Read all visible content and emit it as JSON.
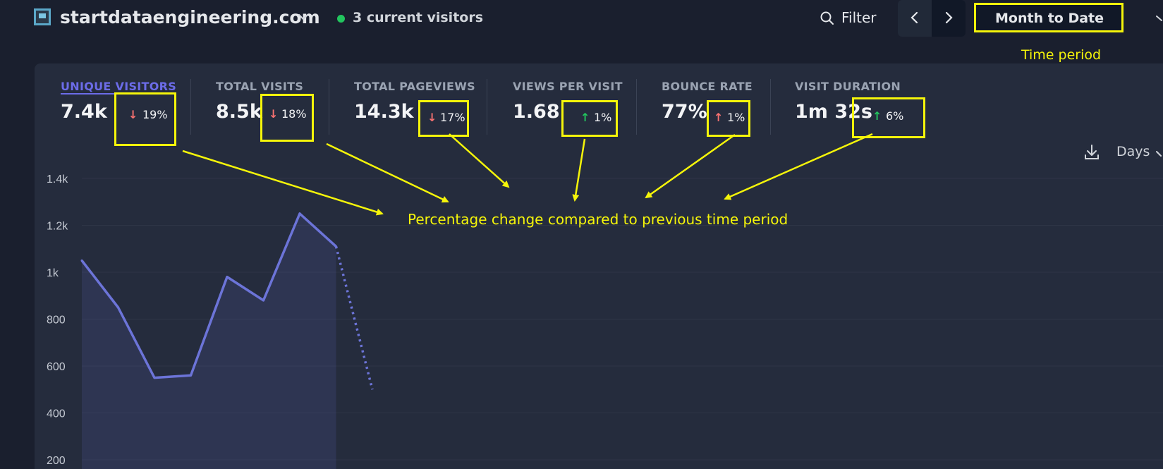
{
  "header": {
    "site_name": "startdataengineering.com",
    "current_visitors": "3 current visitors",
    "filter_label": "Filter",
    "period_label": "Month to Date",
    "period_note": "Time period"
  },
  "metrics": [
    {
      "label": "UNIQUE VISITORS",
      "value": "7.4k",
      "change": "19%",
      "direction": "down",
      "active": true
    },
    {
      "label": "TOTAL VISITS",
      "value": "8.5k",
      "change": "18%",
      "direction": "down"
    },
    {
      "label": "TOTAL PAGEVIEWS",
      "value": "14.3k",
      "change": "17%",
      "direction": "down"
    },
    {
      "label": "VIEWS PER VISIT",
      "value": "1.68",
      "change": "1%",
      "direction": "up"
    },
    {
      "label": "BOUNCE RATE",
      "value": "77%",
      "change": "1%",
      "direction": "up"
    },
    {
      "label": "VISIT DURATION",
      "value": "1m 32s",
      "change": "6%",
      "direction": "up"
    }
  ],
  "chart_controls": {
    "granularity": "Days"
  },
  "annotation": "Percentage change compared to previous time period",
  "colors": {
    "accent": "#6c6ce8",
    "line": "#6c74d8",
    "decrease": "#f87171",
    "increase": "#22c55e",
    "highlight": "#f5f50a"
  },
  "chart_data": {
    "type": "line",
    "title": "",
    "xlabel": "",
    "ylabel": "",
    "y_ticks": [
      "1.4k",
      "1.2k",
      "1k",
      "800",
      "600",
      "400",
      "200"
    ],
    "y_tick_values": [
      1400,
      1200,
      1000,
      800,
      600,
      400,
      200
    ],
    "ylim": [
      200,
      1400
    ],
    "grid": true,
    "series": [
      {
        "values": [
          1050,
          850,
          550,
          560,
          980,
          880,
          1250,
          1110
        ],
        "style": "solid"
      },
      {
        "values": [
          1110,
          500
        ],
        "style": "dotted",
        "starts_at_index": 7
      }
    ]
  }
}
